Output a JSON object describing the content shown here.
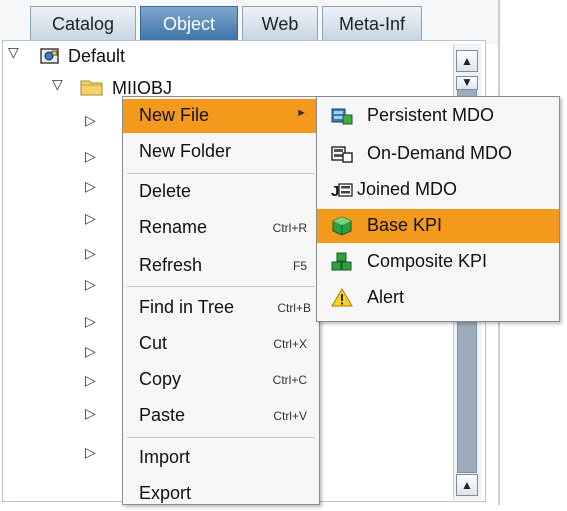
{
  "tabs": [
    {
      "label": "Catalog"
    },
    {
      "label": "Object"
    },
    {
      "label": "Web"
    },
    {
      "label": "Meta-Inf"
    }
  ],
  "tree": {
    "root_label": "Default",
    "folder_label": "MIIOBJ"
  },
  "context_menu": {
    "items": [
      {
        "label": "New File",
        "shortcut": ""
      },
      {
        "label": "New Folder",
        "shortcut": ""
      },
      {
        "label": "Delete",
        "shortcut": ""
      },
      {
        "label": "Rename",
        "shortcut": "Ctrl+R"
      },
      {
        "label": "Refresh",
        "shortcut": "F5"
      },
      {
        "label": "Find in Tree",
        "shortcut": "Ctrl+B"
      },
      {
        "label": "Cut",
        "shortcut": "Ctrl+X"
      },
      {
        "label": "Copy",
        "shortcut": "Ctrl+C"
      },
      {
        "label": "Paste",
        "shortcut": "Ctrl+V"
      },
      {
        "label": "Import",
        "shortcut": ""
      },
      {
        "label": "Export",
        "shortcut": ""
      }
    ]
  },
  "submenu": {
    "items": [
      {
        "label": "Persistent MDO",
        "icon": "persistent-mdo-icon"
      },
      {
        "label": "On-Demand MDO",
        "icon": "on-demand-mdo-icon"
      },
      {
        "label": "Joined MDO",
        "icon": "joined-mdo-icon"
      },
      {
        "label": "Base KPI",
        "icon": "base-kpi-icon"
      },
      {
        "label": "Composite KPI",
        "icon": "composite-kpi-icon"
      },
      {
        "label": "Alert",
        "icon": "alert-icon"
      }
    ]
  },
  "colors": {
    "highlight": "#f39a1c",
    "active_tab": "#3e74a9"
  }
}
